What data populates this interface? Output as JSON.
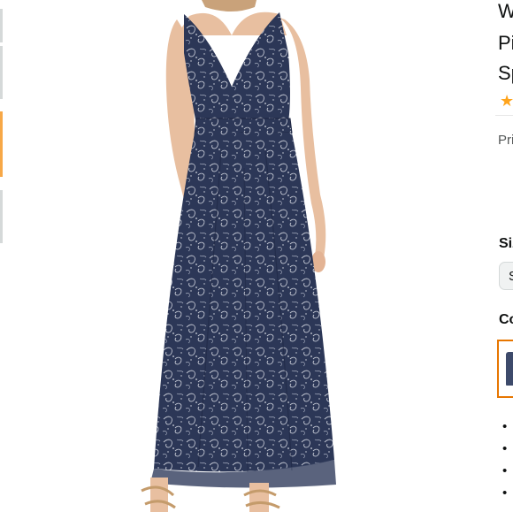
{
  "product": {
    "title_lines": [
      "W",
      "Pi",
      "Sp"
    ],
    "rating_stars": "★",
    "price_label": "Pri",
    "size": {
      "label": "Siz",
      "selected": "S"
    },
    "color": {
      "label": "Co"
    },
    "bullets": [
      "•",
      "•",
      "•",
      "•"
    ]
  },
  "colors": {
    "dress_navy": "#2c3757",
    "print_light": "#c9cdd8",
    "skin": "#e8bfa0",
    "selected_border": "#e77600",
    "thumb_active": "#f7a847",
    "star": "#ffa41c"
  },
  "icons": {
    "rating": "star-icon"
  }
}
